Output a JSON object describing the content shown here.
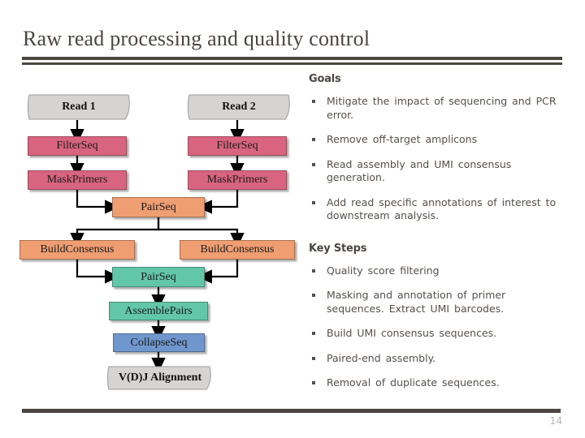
{
  "slide": {
    "title": "Raw read processing and quality control",
    "page_number": "14"
  },
  "flowchart": {
    "nodes": {
      "read1": "Read 1",
      "read2": "Read 2",
      "filterseq_1": "FilterSeq",
      "filterseq_2": "FilterSeq",
      "maskprimers_1": "MaskPrimers",
      "maskprimers_2": "MaskPrimers",
      "pairseq_1": "PairSeq",
      "buildconsensus_1": "BuildConsensus",
      "buildconsensus_2": "BuildConsensus",
      "pairseq_2": "PairSeq",
      "assemblepairs": "AssemblePairs",
      "collapseseq": "CollapseSeq",
      "vdj_alignment": "V(D)J Alignment"
    },
    "colors": {
      "input_output": "#d5d4d2",
      "filter_stage": "#d8647f",
      "pair_stage": "#ef9e72",
      "assembly_stage": "#62c7a7",
      "collapse_stage": "#6f97cd",
      "connector": "#000000"
    }
  },
  "goals": {
    "heading": "Goals",
    "items": [
      "Mitigate the impact of sequencing and PCR error.",
      "Remove off-target amplicons",
      "Read assembly and UMI consensus generation.",
      "Add read specific annotations of interest to downstream analysis."
    ]
  },
  "key_steps": {
    "heading": "Key Steps",
    "items": [
      "Quality score filtering",
      "Masking and annotation of primer sequences. Extract UMI barcodes.",
      "Build UMI consensus sequences.",
      "Paired-end assembly.",
      "Removal of duplicate sequences."
    ]
  },
  "theme": {
    "rule_color": "#4b463f",
    "title_color": "#4a4540",
    "body_text_color": "#55504b",
    "page_number_color": "#b9b5b0"
  }
}
